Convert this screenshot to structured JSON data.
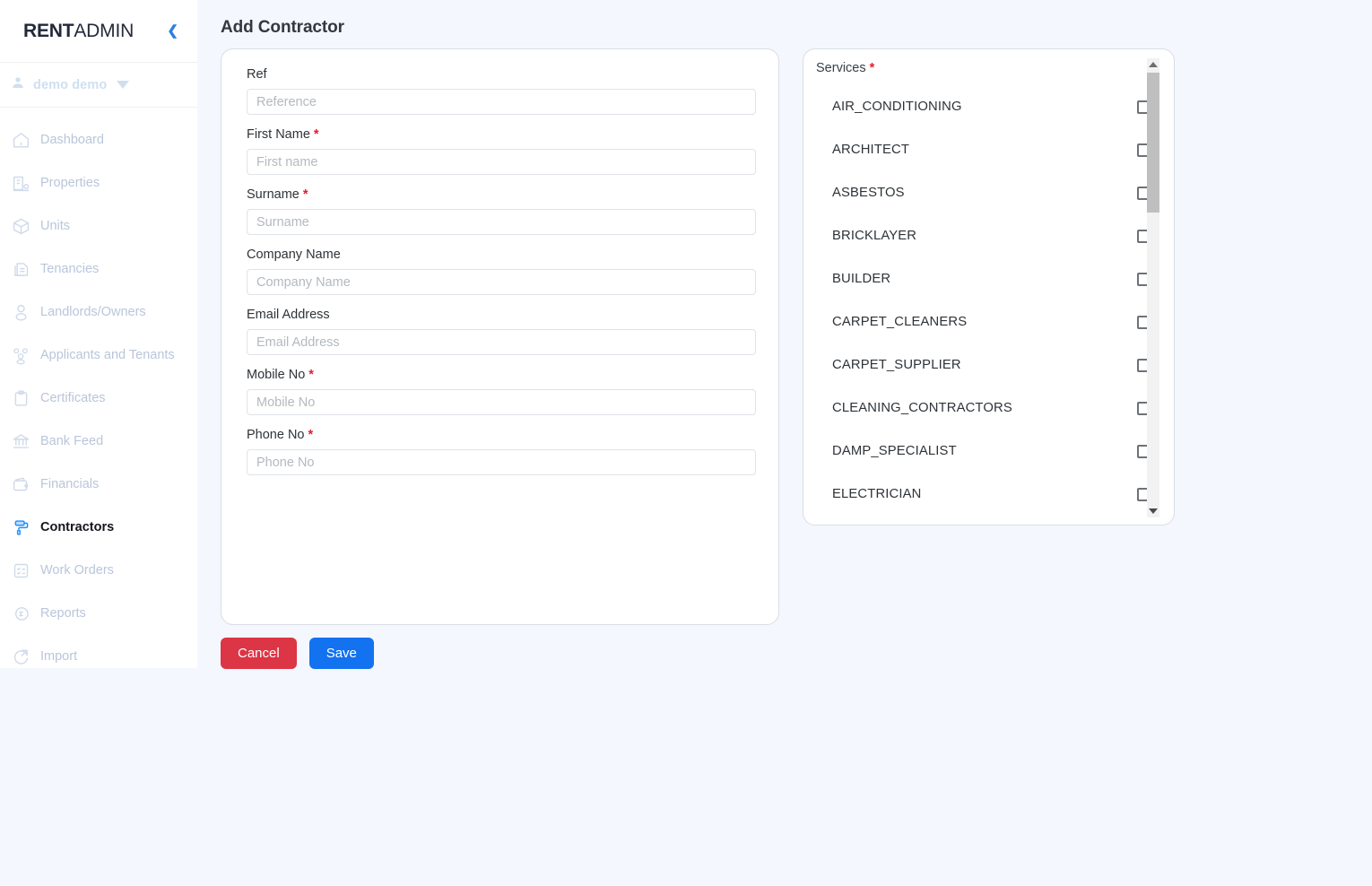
{
  "sidebar": {
    "brand_bold": "RENT",
    "brand_light": "ADMIN",
    "collapse_icon": "chevron-left-icon",
    "user": {
      "name": "demo demo",
      "avatar_icon": "user-icon",
      "caret_icon": "caret-down-icon"
    },
    "items": [
      {
        "label": "Dashboard",
        "icon": "home-icon",
        "active": false
      },
      {
        "label": "Properties",
        "icon": "building-icon",
        "active": false
      },
      {
        "label": "Units",
        "icon": "cube-icon",
        "active": false
      },
      {
        "label": "Tenancies",
        "icon": "documents-icon",
        "active": false
      },
      {
        "label": "Landlords/Owners",
        "icon": "person-icon",
        "active": false
      },
      {
        "label": "Applicants and Tenants",
        "icon": "people-icon",
        "active": false
      },
      {
        "label": "Certificates",
        "icon": "clipboard-icon",
        "active": false
      },
      {
        "label": "Bank Feed",
        "icon": "bank-icon",
        "active": false
      },
      {
        "label": "Financials",
        "icon": "wallet-icon",
        "active": false
      },
      {
        "label": "Contractors",
        "icon": "paint-roller-icon",
        "active": true
      },
      {
        "label": "Work Orders",
        "icon": "checklist-icon",
        "active": false
      },
      {
        "label": "Reports",
        "icon": "report-icon",
        "active": false
      },
      {
        "label": "Import",
        "icon": "import-icon",
        "active": false
      }
    ]
  },
  "page": {
    "title": "Add Contractor"
  },
  "form": {
    "fields": [
      {
        "label": "Ref",
        "required": false,
        "placeholder": "Reference",
        "value": ""
      },
      {
        "label": "First Name",
        "required": true,
        "placeholder": "First name",
        "value": ""
      },
      {
        "label": "Surname",
        "required": true,
        "placeholder": "Surname",
        "value": ""
      },
      {
        "label": "Company Name",
        "required": false,
        "placeholder": "Company Name",
        "value": ""
      },
      {
        "label": "Email Address",
        "required": false,
        "placeholder": "Email Address",
        "value": ""
      },
      {
        "label": "Mobile No",
        "required": true,
        "placeholder": "Mobile No",
        "value": ""
      },
      {
        "label": "Phone No",
        "required": true,
        "placeholder": "Phone No",
        "value": ""
      }
    ]
  },
  "actions": {
    "cancel_label": "Cancel",
    "save_label": "Save",
    "cancel_color": "#dc3545",
    "save_color": "#1272ef"
  },
  "services": {
    "label": "Services",
    "required": true,
    "required_marker": "*",
    "items": [
      {
        "name": "AIR_CONDITIONING",
        "checked": false
      },
      {
        "name": "ARCHITECT",
        "checked": false
      },
      {
        "name": "ASBESTOS",
        "checked": false
      },
      {
        "name": "BRICKLAYER",
        "checked": false
      },
      {
        "name": "BUILDER",
        "checked": false
      },
      {
        "name": "CARPET_CLEANERS",
        "checked": false
      },
      {
        "name": "CARPET_SUPPLIER",
        "checked": false
      },
      {
        "name": "CLEANING_CONTRACTORS",
        "checked": false
      },
      {
        "name": "DAMP_SPECIALIST",
        "checked": false
      },
      {
        "name": "ELECTRICIAN",
        "checked": false
      }
    ],
    "scroll_up_icon": "triangle-up-icon",
    "scroll_down_icon": "triangle-down-icon"
  },
  "theme": {
    "page_bg": "#f4f7fd",
    "sidebar_bg": "#ffffff",
    "accent": "#1272ef",
    "required_red": "#e8192c",
    "muted_text": "#b9c6da"
  }
}
